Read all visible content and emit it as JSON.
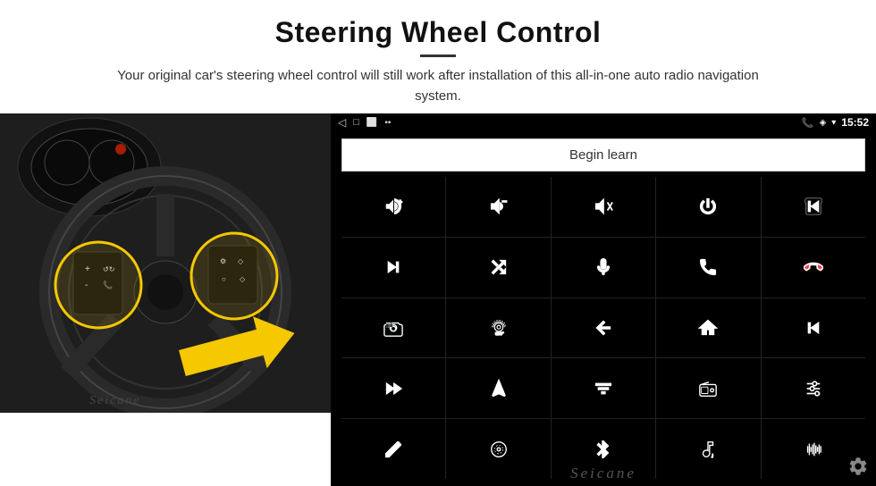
{
  "header": {
    "title": "Steering Wheel Control",
    "subtitle": "Your original car's steering wheel control will still work after installation of this all-in-one auto radio navigation system."
  },
  "status_bar": {
    "back_icon": "◁",
    "home_icon": "□",
    "recents_icon": "⬜",
    "signal_icon": "▪▪",
    "phone_icon": "📞",
    "location_icon": "◈",
    "wifi_icon": "▾",
    "time": "15:52"
  },
  "begin_learn": {
    "label": "Begin learn"
  },
  "controls": [
    {
      "id": "vol-up",
      "icon": "vol_up"
    },
    {
      "id": "vol-down",
      "icon": "vol_down"
    },
    {
      "id": "mute",
      "icon": "mute"
    },
    {
      "id": "power",
      "icon": "power"
    },
    {
      "id": "prev-track-phone",
      "icon": "prev_phone"
    },
    {
      "id": "skip-next",
      "icon": "skip_next"
    },
    {
      "id": "shuffle",
      "icon": "shuffle"
    },
    {
      "id": "mic",
      "icon": "mic"
    },
    {
      "id": "phone",
      "icon": "phone"
    },
    {
      "id": "end-call",
      "icon": "end_call"
    },
    {
      "id": "camera",
      "icon": "camera"
    },
    {
      "id": "camera360",
      "icon": "camera360"
    },
    {
      "id": "back",
      "icon": "back"
    },
    {
      "id": "home",
      "icon": "home"
    },
    {
      "id": "prev-track",
      "icon": "prev_track"
    },
    {
      "id": "fast-forward",
      "icon": "fast_forward"
    },
    {
      "id": "navigation",
      "icon": "navigation"
    },
    {
      "id": "equalizer",
      "icon": "equalizer"
    },
    {
      "id": "radio",
      "icon": "radio"
    },
    {
      "id": "settings2",
      "icon": "settings2"
    },
    {
      "id": "edit",
      "icon": "edit"
    },
    {
      "id": "dvd",
      "icon": "dvd"
    },
    {
      "id": "bluetooth",
      "icon": "bluetooth"
    },
    {
      "id": "music",
      "icon": "music"
    },
    {
      "id": "waveform",
      "icon": "waveform"
    }
  ],
  "watermark": "Seicane",
  "gear_label": "⚙"
}
